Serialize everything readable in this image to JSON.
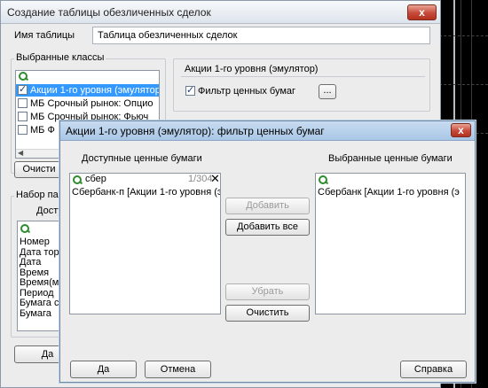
{
  "main_dialog": {
    "title": "Создание таблицы обезличенных сделок",
    "close_glyph": "x",
    "table_name_label": "Имя таблицы",
    "table_name_value": "Таблица обезличенных сделок",
    "classes_group_label": "Выбранные классы",
    "classes": [
      {
        "label": "Акции 1-го уровня (эмулятор)",
        "checked": true,
        "selected": true
      },
      {
        "label": "МБ Срочный рынок: Опцио",
        "checked": false,
        "selected": false
      },
      {
        "label": "МБ Срочный рынок: Фьюч",
        "checked": false,
        "selected": false
      },
      {
        "label": "МБ Ф",
        "checked": false,
        "selected": false
      }
    ],
    "selected_class_title": "Акции 1-го уровня (эмулятор)",
    "filter_checkbox_label": "Фильтр ценных бумаг",
    "filter_checked": true,
    "ellipsis_button": "...",
    "clear_button": "Очисти",
    "params_group_label": "Набор па",
    "params_sub_label": "Досту",
    "params": [
      "Номер",
      "Дата тор",
      "Дата",
      "Время",
      "Время(м",
      "Период",
      "Бумага с",
      "Бумага"
    ],
    "ok_button": "Да"
  },
  "filter_dialog": {
    "title": "Акции 1-го уровня (эмулятор): фильтр ценных бумаг",
    "close_glyph": "x",
    "available_label": "Доступные ценные бумаги",
    "selected_label": "Выбранные ценные бумаги",
    "search_value": "сбер",
    "search_count": "1/304",
    "clear_search_glyph": "✕",
    "available_items": [
      "Сбербанк-п [Акции 1-го уровня (э"
    ],
    "selected_items": [
      "Сбербанк [Акции 1-го уровня (э"
    ],
    "add_button": "Добавить",
    "add_all_button": "Добавить все",
    "remove_button": "Убрать",
    "clear_button": "Очистить",
    "ok_button": "Да",
    "cancel_button": "Отмена",
    "help_button": "Справка"
  }
}
